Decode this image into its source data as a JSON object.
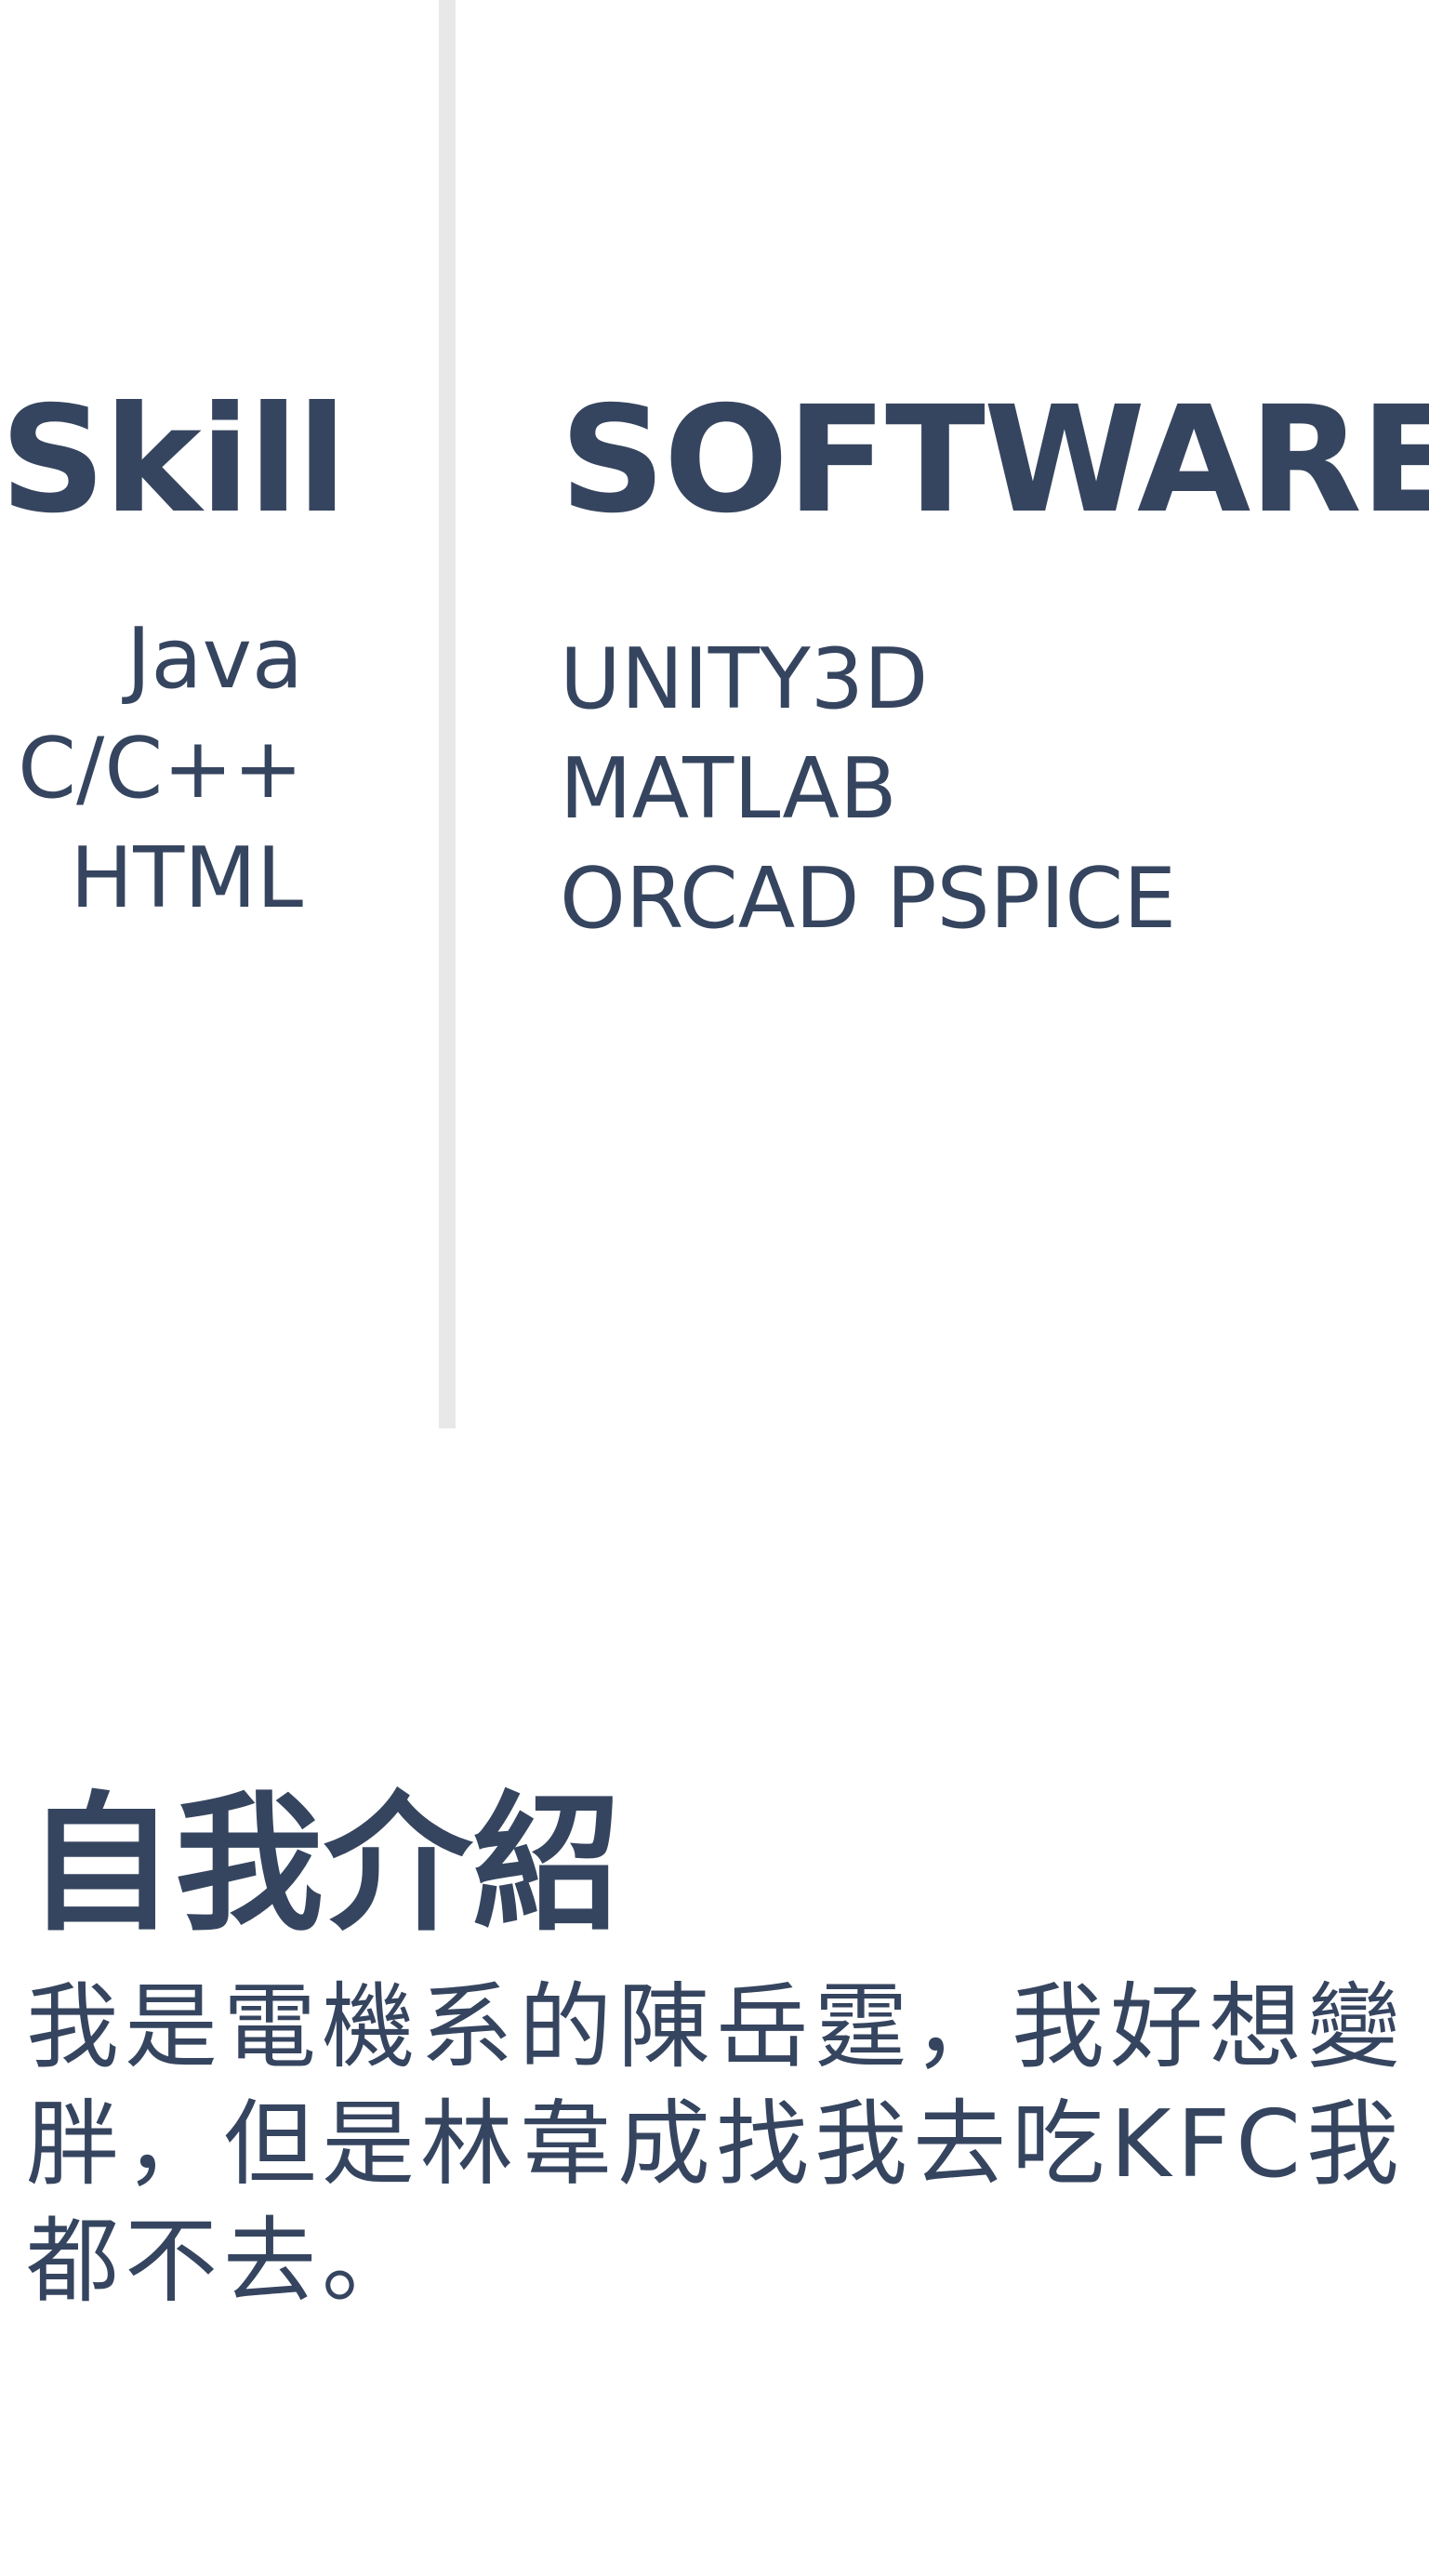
{
  "skills": {
    "heading": "Skill",
    "items": [
      "Java",
      "C/C++",
      "HTML"
    ]
  },
  "software": {
    "heading": "SOFTWARE",
    "items": [
      "UNITY3D",
      "MATLAB",
      "ORCAD PSPICE"
    ]
  },
  "intro": {
    "title": "自我介紹",
    "text": "我是電機系的陳岳霆，我好想變胖，但是林韋成找我去吃KFC我都不去。"
  },
  "colors": {
    "text": "#36455f",
    "divider": "#e8e8e8",
    "background": "#ffffff"
  }
}
